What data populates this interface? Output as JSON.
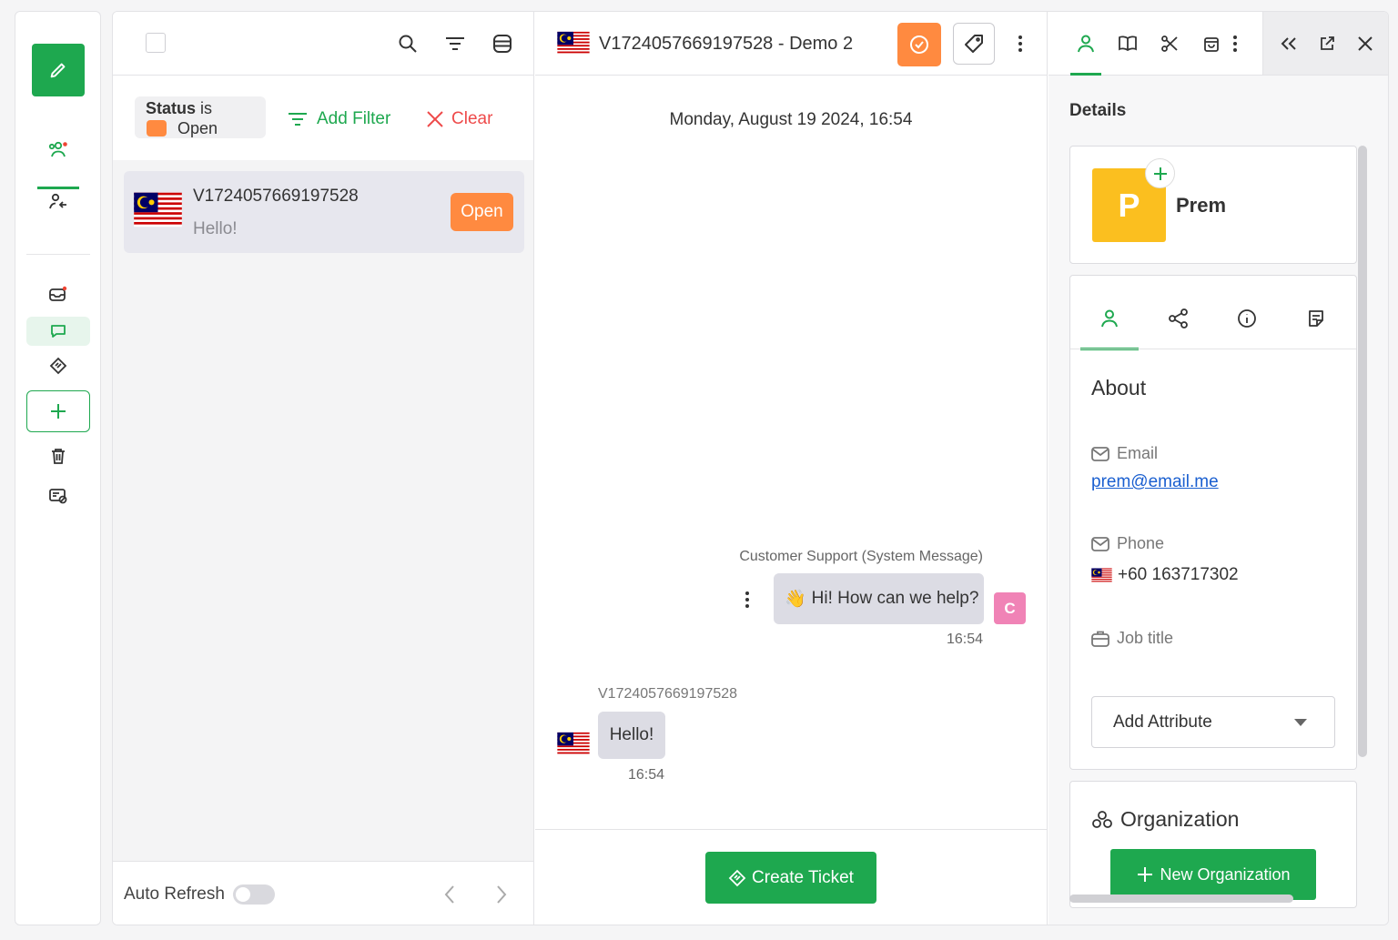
{
  "colors": {
    "brand_green": "#1ea84f",
    "open_orange": "#ff8a40",
    "clear_red": "#ee4a4a",
    "link_blue": "#1a5fd0",
    "avatar_c_pink": "#f083b6",
    "avatar_p_yellow": "#fbbf1f"
  },
  "rail": {
    "icons": [
      "compose-icon",
      "team-icon",
      "assign-user-icon",
      "inbox-icon",
      "chat-icon",
      "ticket-icon",
      "plus-icon",
      "trash-icon",
      "spam-icon"
    ]
  },
  "list": {
    "filter": {
      "status_prefix": "Status",
      "status_suffix": "is",
      "status_value": "Open",
      "add_filter": "Add Filter",
      "clear": "Clear"
    },
    "conversations": [
      {
        "name": "V1724057669197528",
        "preview": "Hello!",
        "status": "Open",
        "flag": "Malaysia"
      }
    ],
    "footer": {
      "auto_refresh": "Auto Refresh",
      "auto_refresh_on": false
    }
  },
  "chat": {
    "title": "V1724057669197528 - Demo 2",
    "date_header": "Monday, August 19 2024, 16:54",
    "messages": [
      {
        "sender": "Customer Support (System Message)",
        "text": "Hi! How can we help?",
        "time": "16:54",
        "avatar": "C",
        "emoji": "👋"
      },
      {
        "sender": "V1724057669197528",
        "text": "Hello!",
        "time": "16:54"
      }
    ],
    "create_ticket": "Create Ticket"
  },
  "details": {
    "title": "Details",
    "contact": {
      "initial": "P",
      "name": "Prem"
    },
    "about": {
      "heading": "About",
      "email_label": "Email",
      "email_value": "prem@email.me",
      "phone_label": "Phone",
      "phone_value": "+60 163717302",
      "job_label": "Job title",
      "add_attribute": "Add Attribute"
    },
    "organization": {
      "heading": "Organization",
      "new_button": "New Organization"
    }
  }
}
